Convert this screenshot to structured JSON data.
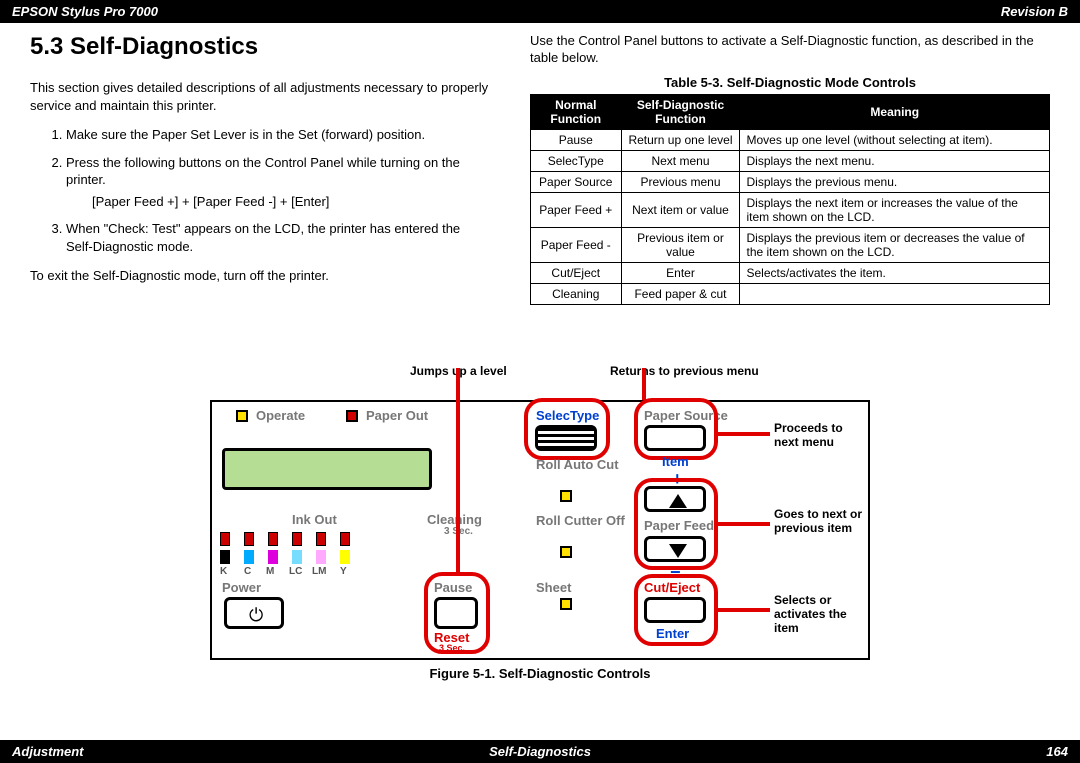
{
  "header": {
    "left": "EPSON Stylus Pro 7000",
    "right": "Revision B"
  },
  "footer": {
    "left": "Adjustment",
    "center": "Self-Diagnostics",
    "right": "164"
  },
  "section_title": "5.3  Self-Diagnostics",
  "intro": "This section gives detailed descriptions of all adjustments necessary to properly service and maintain this printer.",
  "steps": {
    "s1": "Make sure the Paper Set Lever is in the Set (forward) position.",
    "s2": "Press the following buttons on the Control Panel while turning on the printer.",
    "s2_keys": "[Paper Feed +] + [Paper Feed -] + [Enter]",
    "s3": "When \"Check: Test\" appears on the LCD, the printer has entered the Self-Diagnostic mode."
  },
  "exit": "To exit the Self-Diagnostic mode, turn off the printer.",
  "right_intro": "Use the Control Panel buttons to activate a Self-Diagnostic function, as described in the table below.",
  "table_caption": "Table 5-3.  Self-Diagnostic Mode Controls",
  "table_headers": {
    "h1": "Normal Function",
    "h2": "Self-Diagnostic Function",
    "h3": "Meaning"
  },
  "table_rows": [
    {
      "c1": "Pause",
      "c2": "Return up one level",
      "c3": "Moves up one level (without selecting at item)."
    },
    {
      "c1": "SelecType",
      "c2": "Next menu",
      "c3": "Displays the next menu."
    },
    {
      "c1": "Paper Source",
      "c2": "Previous menu",
      "c3": "Displays the previous menu."
    },
    {
      "c1": "Paper Feed +",
      "c2": "Next item or value",
      "c3": "Displays the next item or increases the value of the item shown on the LCD."
    },
    {
      "c1": "Paper Feed -",
      "c2": "Previous item or value",
      "c3": "Displays the previous item or decreases the value of the item shown on the LCD."
    },
    {
      "c1": "Cut/Eject",
      "c2": "Enter",
      "c3": "Selects/activates the item."
    },
    {
      "c1": "Cleaning",
      "c2": "Feed paper & cut",
      "c3": ""
    }
  ],
  "figure_caption": "Figure 5-1.  Self-Diagnostic Controls",
  "annot": {
    "jumps": "Jumps up a level",
    "returns": "Returns to previous menu",
    "proceeds": "Proceeds to next menu",
    "goesto": "Goes to next or previous item",
    "selects": "Selects or activates the item"
  },
  "panel": {
    "operate": "Operate",
    "paperout": "Paper Out",
    "inkout": "Ink Out",
    "cleaning": "Cleaning",
    "cleaning_sub": "3 Sec.",
    "power": "Power",
    "pause": "Pause",
    "reset": "Reset",
    "reset_sub": "3 Sec.",
    "selectype": "SelecType",
    "papersource": "Paper Source",
    "item": "Item",
    "rollauto": "Roll Auto Cut",
    "paperfeed": "Paper Feed",
    "rollcutter": "Roll Cutter Off",
    "plus": "+",
    "minus": "−",
    "sheet": "Sheet",
    "cuteject": "Cut/Eject",
    "enter": "Enter",
    "inks": {
      "k": "K",
      "c": "C",
      "m": "M",
      "lc": "LC",
      "lm": "LM",
      "y": "Y"
    }
  }
}
